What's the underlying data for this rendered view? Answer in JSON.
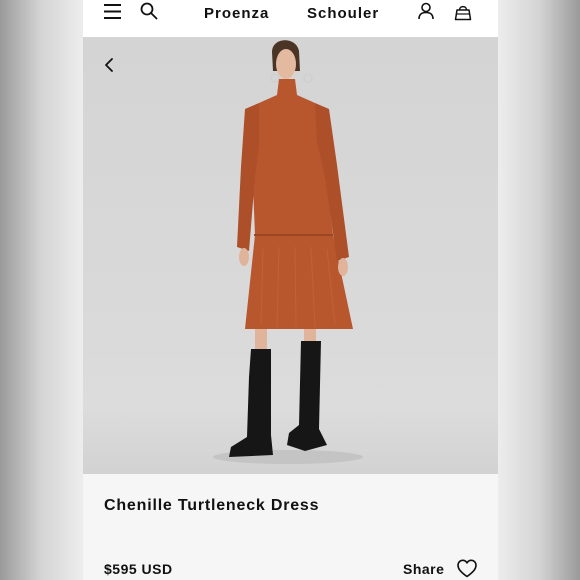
{
  "header": {
    "brand_left": "Proenza",
    "brand_right": "Schouler",
    "icons": [
      "menu-icon",
      "search-icon",
      "user-icon",
      "bag-icon"
    ]
  },
  "hero": {
    "back_icon": "chevron-left-icon",
    "background_color": "#d8d8d8",
    "dress_color": "#b8562e"
  },
  "product": {
    "title": "Chenille Turtleneck Dress",
    "price": "$595 USD",
    "share_label": "Share",
    "favorite_icon": "heart-icon"
  }
}
